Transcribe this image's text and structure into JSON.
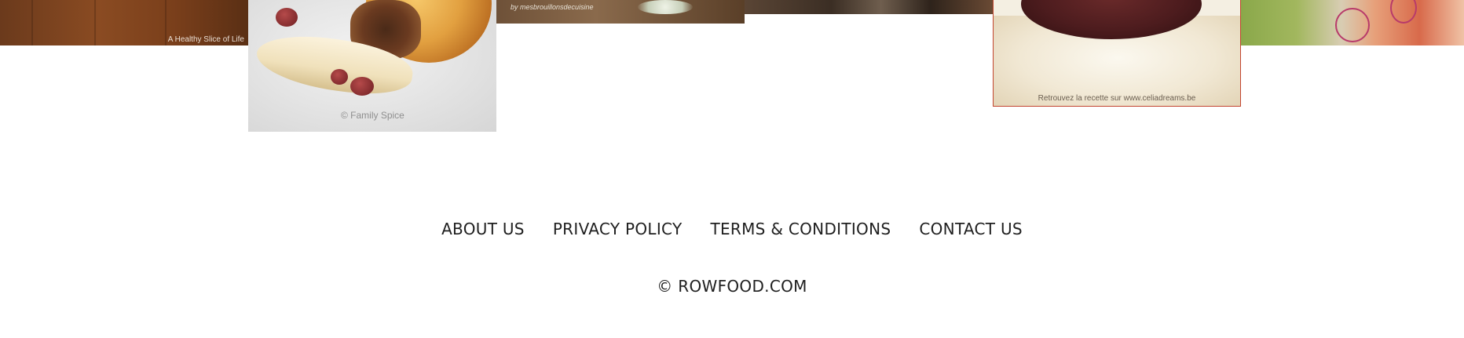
{
  "gallery": {
    "tiles": [
      {
        "caption": "A Healthy Slice of Life"
      },
      {
        "caption": "© Family Spice"
      },
      {
        "caption": "by mesbrouillonsdecuisine"
      },
      {
        "caption": ""
      },
      {
        "caption": "Retrouvez la recette sur www.celiadreams.be"
      },
      {
        "caption": ""
      }
    ]
  },
  "footer": {
    "nav": [
      {
        "label": "ABOUT US"
      },
      {
        "label": "PRIVACY POLICY"
      },
      {
        "label": "TERMS & CONDITIONS"
      },
      {
        "label": "CONTACT US"
      }
    ],
    "copyright": "© ROWFOOD.COM"
  },
  "colors": {
    "background": "#ffffff",
    "footer_text": "#1f1f1f",
    "tile_border_accent": "#c2452f"
  }
}
